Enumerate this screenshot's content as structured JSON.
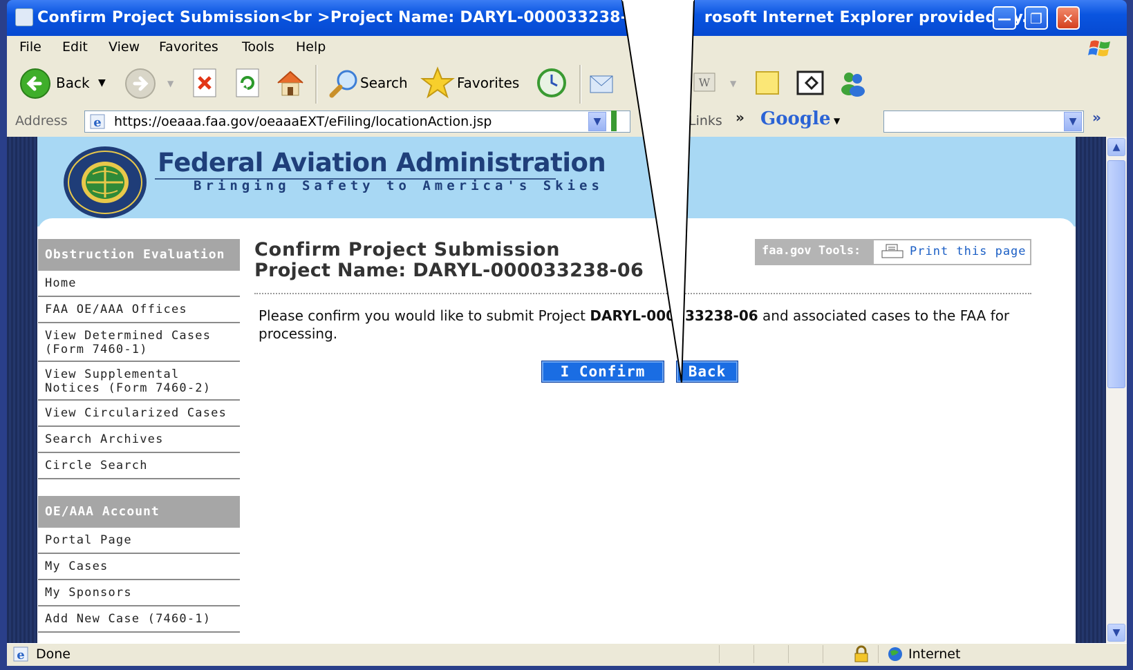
{
  "window": {
    "title": "Confirm Project Submission<br >Project Name: DARYL-000033238-0",
    "title_tail": "rosoft Internet Explorer provided by..."
  },
  "menu": [
    "File",
    "Edit",
    "View",
    "Favorites",
    "Tools",
    "Help"
  ],
  "toolbar": {
    "back_label": "Back",
    "search_label": "Search",
    "favorites_label": "Favorites"
  },
  "addressbar": {
    "label": "Address",
    "url": "https://oeaaa.faa.gov/oeaaaEXT/eFiling/locationAction.jsp",
    "links_label": "Links",
    "chevron": "»",
    "google_label": "Google"
  },
  "header": {
    "title": "Federal Aviation Administration",
    "tagline": "Bringing Safety to America's Skies",
    "seal_text_top": "FEDERAL AVIATION",
    "seal_text_bottom": "ADMINISTRATION"
  },
  "sidebar": {
    "section1_title": "Obstruction Evaluation",
    "section1_items": [
      "Home",
      "FAA OE/AAA Offices",
      "View Determined Cases (Form 7460-1)",
      "View Supplemental Notices (Form 7460-2)",
      "View Circularized Cases",
      "Search Archives",
      "Circle Search"
    ],
    "section2_title": "OE/AAA Account",
    "section2_items": [
      "Portal Page",
      "My Cases",
      "My Sponsors",
      "Add New Case (7460-1)"
    ]
  },
  "main": {
    "title_line1": "Confirm Project Submission",
    "title_line2": "Project Name: DARYL-000033238-06",
    "tools_label": "faa.gov Tools:",
    "print_label": "Print this page",
    "message_pre": "Please confirm you would like to submit Project ",
    "message_project": "DARYL-000033238-06",
    "message_post": " and associated cases to the FAA for processing.",
    "confirm_button": "I Confirm",
    "back_button": "Back"
  },
  "statusbar": {
    "status": "Done",
    "zone": "Internet"
  },
  "colors": {
    "titlebar": "#0a55e0",
    "header_bg": "#a8d8f4",
    "button_bg": "#1a6de3",
    "sidebar_head": "#a6a6a6"
  }
}
